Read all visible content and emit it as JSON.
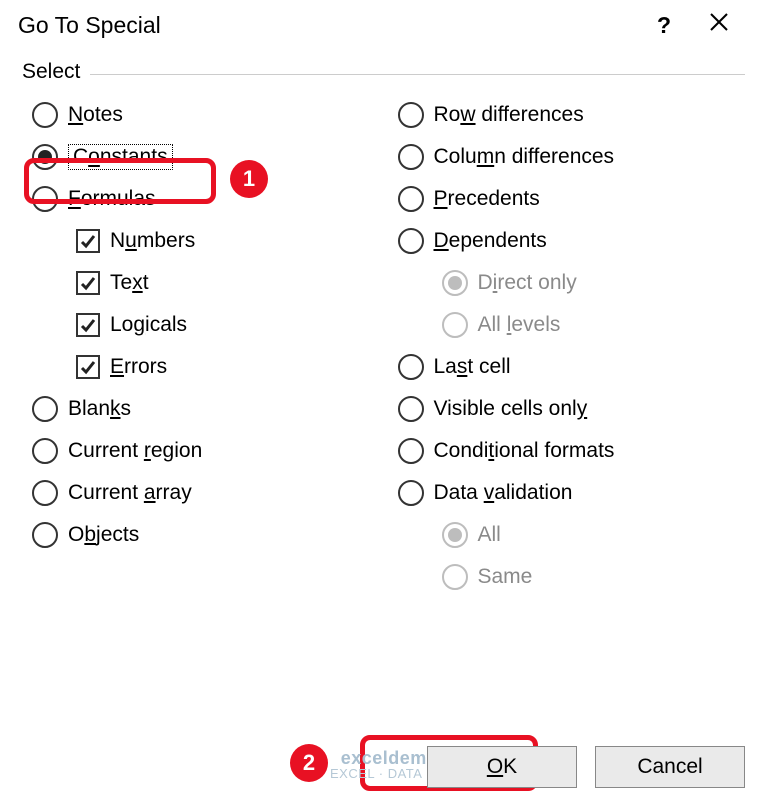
{
  "title": "Go To Special",
  "help_symbol": "?",
  "group_label": "Select",
  "left": {
    "notes": {
      "label_pre": "",
      "u": "N",
      "label_post": "otes"
    },
    "constants": {
      "label_pre": "C",
      "u": "o",
      "label_post": "nstants"
    },
    "formulas": {
      "label_pre": "",
      "u": "F",
      "label_post": "ormulas"
    },
    "numbers": {
      "label_pre": "N",
      "u": "u",
      "label_post": "mbers"
    },
    "text": {
      "label_pre": "Te",
      "u": "x",
      "label_post": "t"
    },
    "logicals": {
      "label_pre": "Lo",
      "u": "g",
      "label_post": "icals"
    },
    "errors": {
      "label_pre": "",
      "u": "E",
      "label_post": "rrors"
    },
    "blanks": {
      "label_pre": "Blan",
      "u": "k",
      "label_post": "s"
    },
    "current_region": {
      "label_pre": "Current ",
      "u": "r",
      "label_post": "egion"
    },
    "current_array": {
      "label_pre": "Current ",
      "u": "a",
      "label_post": "rray"
    },
    "objects": {
      "label_pre": "O",
      "u": "b",
      "label_post": "jects"
    }
  },
  "right": {
    "row_diff": {
      "label_pre": "Ro",
      "u": "w",
      "label_post": " differences"
    },
    "col_diff": {
      "label_pre": "Colu",
      "u": "m",
      "label_post": "n differences"
    },
    "precedents": {
      "label_pre": "",
      "u": "P",
      "label_post": "recedents"
    },
    "dependents": {
      "label_pre": "",
      "u": "D",
      "label_post": "ependents"
    },
    "direct_only": {
      "label_pre": "D",
      "u": "i",
      "label_post": "rect only"
    },
    "all_levels": {
      "label_pre": "All ",
      "u": "l",
      "label_post": "evels"
    },
    "last_cell": {
      "label_pre": "La",
      "u": "s",
      "label_post": "t cell"
    },
    "visible": {
      "label_pre": "Visible cells onl",
      "u": "y",
      "label_post": ""
    },
    "cond_formats": {
      "label_pre": "Condi",
      "u": "t",
      "label_post": "ional formats"
    },
    "data_valid": {
      "label_pre": "Data ",
      "u": "v",
      "label_post": "alidation"
    },
    "all": {
      "label_pre": "All",
      "u": "",
      "label_post": ""
    },
    "same": {
      "label_pre": "Same",
      "u": "",
      "label_post": ""
    }
  },
  "buttons": {
    "ok": {
      "pre": "",
      "u": "O",
      "post": "K"
    },
    "cancel": {
      "pre": "Cancel",
      "u": "",
      "post": ""
    }
  },
  "annotations": {
    "one": "1",
    "two": "2"
  },
  "watermark": {
    "line1": "exceldemy",
    "line2": "EXCEL · DATA · BI"
  }
}
